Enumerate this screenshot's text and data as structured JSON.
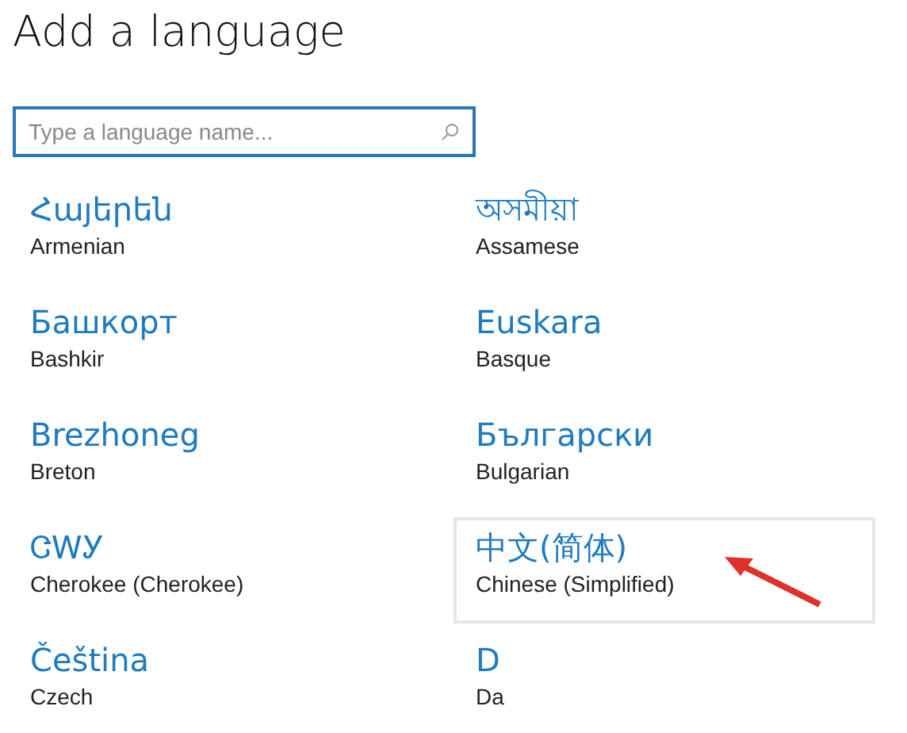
{
  "title": "Add a language",
  "search": {
    "placeholder": "Type a language name..."
  },
  "languages": [
    {
      "native": "Հայերեն",
      "english": "Armenian",
      "selected": false
    },
    {
      "native": "অসমীয়া",
      "english": "Assamese",
      "selected": false
    },
    {
      "native": "Башкорт",
      "english": "Bashkir",
      "selected": false
    },
    {
      "native": "Euskara",
      "english": "Basque",
      "selected": false
    },
    {
      "native": "Brezhoneg",
      "english": "Breton",
      "selected": false
    },
    {
      "native": "Български",
      "english": "Bulgarian",
      "selected": false
    },
    {
      "native": "ᏣᎳᎩ",
      "english": "Cherokee (Cherokee)",
      "selected": false
    },
    {
      "native": "中文(简体)",
      "english": "Chinese (Simplified)",
      "selected": true
    },
    {
      "native": "Čeština",
      "english": "Czech",
      "selected": false
    },
    {
      "native": "D",
      "english": "Da",
      "selected": false
    }
  ]
}
